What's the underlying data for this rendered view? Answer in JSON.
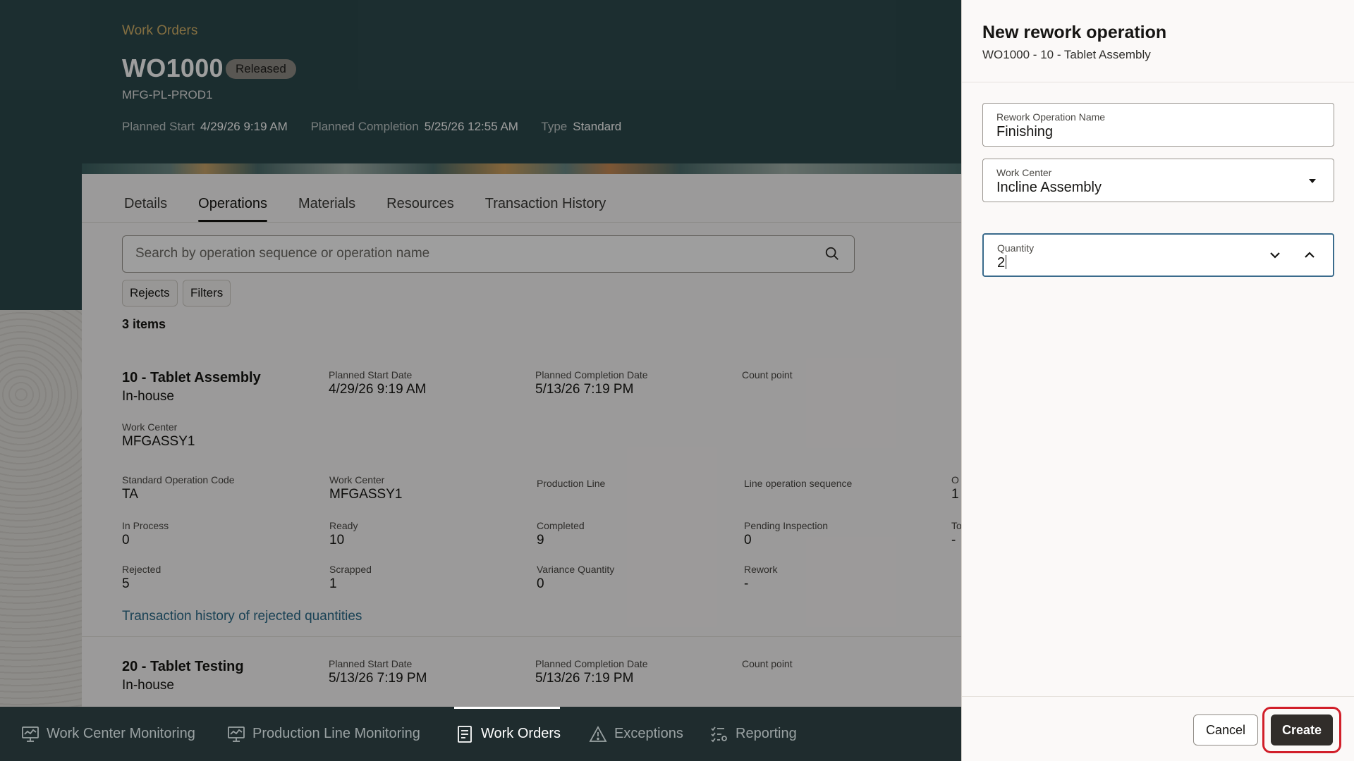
{
  "header": {
    "breadcrumb": "Work Orders",
    "work_order": "WO1000",
    "status": "Released",
    "org_code": "MFG-PL-PROD1",
    "meta": [
      {
        "label": "Planned Start",
        "value": "4/29/26 9:19 AM"
      },
      {
        "label": "Planned Completion",
        "value": "5/25/26 12:55 AM"
      },
      {
        "label": "Type",
        "value": "Standard"
      }
    ]
  },
  "tabs": [
    "Details",
    "Operations",
    "Materials",
    "Resources",
    "Transaction History"
  ],
  "active_tab": "Operations",
  "search": {
    "placeholder": "Search by operation sequence or operation name"
  },
  "chips": {
    "rejects": "Rejects",
    "filters": "Filters"
  },
  "items_count": "3 items",
  "operations": [
    {
      "title": "10 - Tablet Assembly",
      "type": "In-house",
      "planned_start_label": "Planned Start Date",
      "planned_start": "4/29/26 9:19 AM",
      "planned_completion_label": "Planned Completion Date",
      "planned_completion": "5/13/26 7:19 PM",
      "count_point_label": "Count point",
      "work_center_label": "Work Center",
      "work_center": "MFGASSY1",
      "details": {
        "std_op_code_label": "Standard Operation Code",
        "std_op_code": "TA",
        "work_center_label": "Work Center",
        "work_center": "MFGASSY1",
        "production_line_label": "Production Line",
        "line_op_seq_label": "Line operation sequence",
        "extra_col_label": "O",
        "extra_col_value": "1",
        "in_process_label": "In Process",
        "in_process": "0",
        "ready_label": "Ready",
        "ready": "10",
        "completed_label": "Completed",
        "completed": "9",
        "pending_inspection_label": "Pending Inspection",
        "pending_inspection": "0",
        "extra_col2_label": "To",
        "extra_col2_value": "-",
        "rejected_label": "Rejected",
        "rejected": "5",
        "scrapped_label": "Scrapped",
        "scrapped": "1",
        "variance_label": "Variance Quantity",
        "variance": "0",
        "rework_label": "Rework",
        "rework": "-"
      },
      "link": "Transaction history of rejected quantities"
    },
    {
      "title": "20 - Tablet Testing",
      "type": "In-house",
      "planned_start_label": "Planned Start Date",
      "planned_start": "5/13/26 7:19 PM",
      "planned_completion_label": "Planned Completion Date",
      "planned_completion": "5/13/26 7:19 PM",
      "count_point_label": "Count point"
    }
  ],
  "bottom_nav": [
    {
      "label": "Work Center Monitoring",
      "icon": "monitor-icon"
    },
    {
      "label": "Production Line Monitoring",
      "icon": "monitor-icon"
    },
    {
      "label": "Work Orders",
      "icon": "document-icon",
      "active": true
    },
    {
      "label": "Exceptions",
      "icon": "warning-icon"
    },
    {
      "label": "Reporting",
      "icon": "report-list-icon"
    }
  ],
  "drawer": {
    "title": "New rework operation",
    "subtitle": "WO1000 - 10 - Tablet Assembly",
    "fields": {
      "name_label": "Rework Operation Name",
      "name_value": "Finishing",
      "work_center_label": "Work Center",
      "work_center_value": "Incline Assembly",
      "quantity_label": "Quantity",
      "quantity_value": "2"
    },
    "cancel": "Cancel",
    "create": "Create"
  },
  "colors": {
    "hero": "#2d4a4d",
    "accent_gold": "#d6b36a",
    "link": "#2b6b8a",
    "primary_button": "#312d2a",
    "highlight_ring": "#d11f2a"
  }
}
